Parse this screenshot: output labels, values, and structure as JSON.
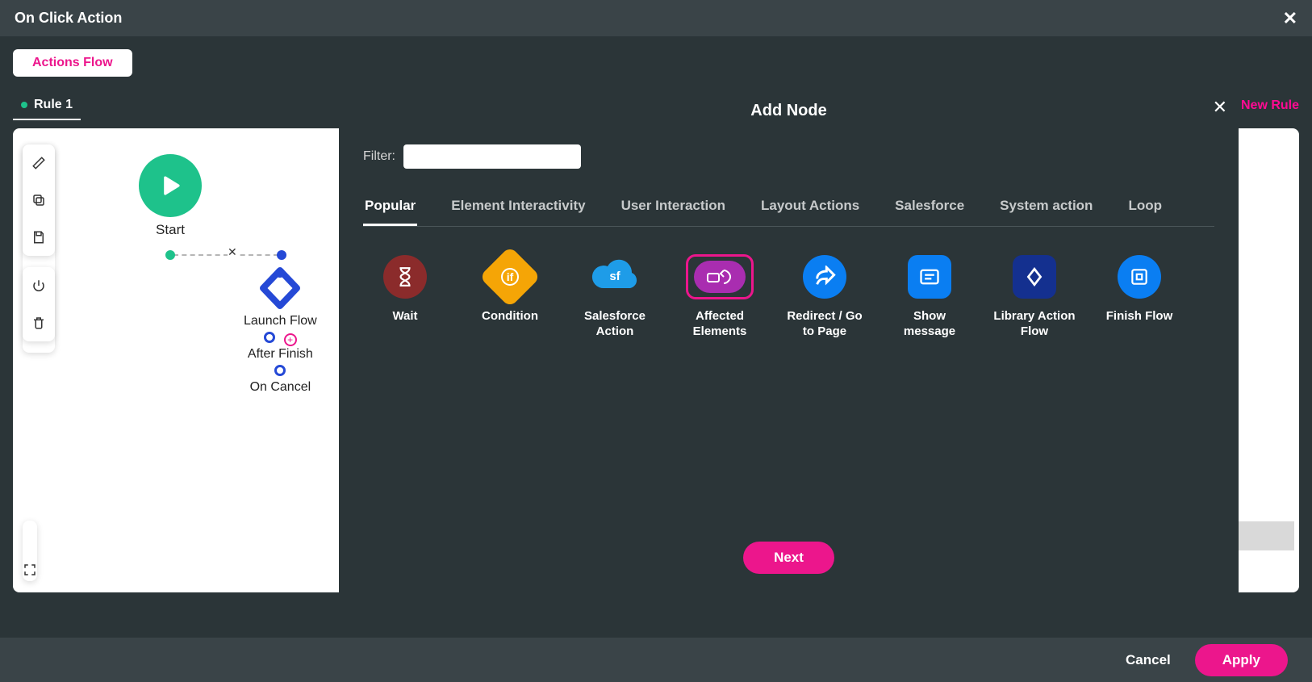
{
  "title": "On Click Action",
  "actions_flow_tab": "Actions Flow",
  "rule_tab_label": "Rule 1",
  "new_rule_label": "New Rule",
  "flow": {
    "start_label": "Start",
    "launch_label": "Launch Flow",
    "after_finish_label": "After Finish",
    "on_cancel_label": "On Cancel"
  },
  "panel": {
    "title": "Add Node",
    "filter_label": "Filter:",
    "filter_value": "",
    "tabs": [
      "Popular",
      "Element Interactivity",
      "User Interaction",
      "Layout Actions",
      "Salesforce",
      "System action",
      "Loop"
    ],
    "active_tab": "Popular",
    "nodes": [
      {
        "key": "wait",
        "label": "Wait",
        "color": "#8b2b2b"
      },
      {
        "key": "condition",
        "label": "Condition",
        "color": "#f5a506"
      },
      {
        "key": "salesforce",
        "label": "Salesforce Action",
        "color": "#1e9ce8"
      },
      {
        "key": "affected",
        "label": "Affected Elements",
        "color": "#a92db0",
        "selected": true
      },
      {
        "key": "redirect",
        "label": "Redirect / Go to Page",
        "color": "#0a7ef2"
      },
      {
        "key": "show-message",
        "label": "Show message",
        "color": "#0a7ef2"
      },
      {
        "key": "library-flow",
        "label": "Library Action Flow",
        "color": "#14308f"
      },
      {
        "key": "finish",
        "label": "Finish Flow",
        "color": "#0a7ef2"
      }
    ],
    "next_button": "Next"
  },
  "footer": {
    "cancel": "Cancel",
    "apply": "Apply"
  }
}
